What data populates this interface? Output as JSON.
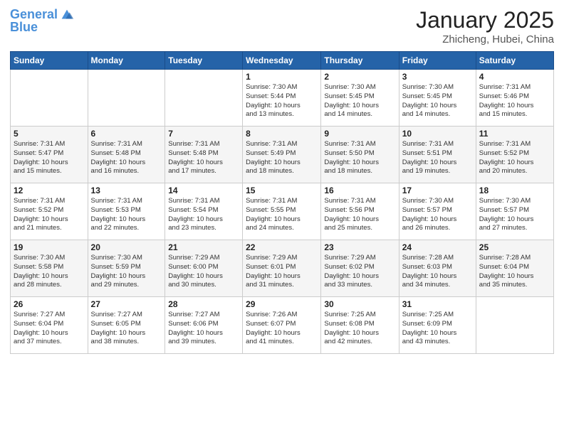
{
  "header": {
    "logo_line1": "General",
    "logo_line2": "Blue",
    "month": "January 2025",
    "location": "Zhicheng, Hubei, China"
  },
  "weekdays": [
    "Sunday",
    "Monday",
    "Tuesday",
    "Wednesday",
    "Thursday",
    "Friday",
    "Saturday"
  ],
  "weeks": [
    [
      {
        "day": "",
        "info": ""
      },
      {
        "day": "",
        "info": ""
      },
      {
        "day": "",
        "info": ""
      },
      {
        "day": "1",
        "info": "Sunrise: 7:30 AM\nSunset: 5:44 PM\nDaylight: 10 hours\nand 13 minutes."
      },
      {
        "day": "2",
        "info": "Sunrise: 7:30 AM\nSunset: 5:45 PM\nDaylight: 10 hours\nand 14 minutes."
      },
      {
        "day": "3",
        "info": "Sunrise: 7:30 AM\nSunset: 5:45 PM\nDaylight: 10 hours\nand 14 minutes."
      },
      {
        "day": "4",
        "info": "Sunrise: 7:31 AM\nSunset: 5:46 PM\nDaylight: 10 hours\nand 15 minutes."
      }
    ],
    [
      {
        "day": "5",
        "info": "Sunrise: 7:31 AM\nSunset: 5:47 PM\nDaylight: 10 hours\nand 15 minutes."
      },
      {
        "day": "6",
        "info": "Sunrise: 7:31 AM\nSunset: 5:48 PM\nDaylight: 10 hours\nand 16 minutes."
      },
      {
        "day": "7",
        "info": "Sunrise: 7:31 AM\nSunset: 5:48 PM\nDaylight: 10 hours\nand 17 minutes."
      },
      {
        "day": "8",
        "info": "Sunrise: 7:31 AM\nSunset: 5:49 PM\nDaylight: 10 hours\nand 18 minutes."
      },
      {
        "day": "9",
        "info": "Sunrise: 7:31 AM\nSunset: 5:50 PM\nDaylight: 10 hours\nand 18 minutes."
      },
      {
        "day": "10",
        "info": "Sunrise: 7:31 AM\nSunset: 5:51 PM\nDaylight: 10 hours\nand 19 minutes."
      },
      {
        "day": "11",
        "info": "Sunrise: 7:31 AM\nSunset: 5:52 PM\nDaylight: 10 hours\nand 20 minutes."
      }
    ],
    [
      {
        "day": "12",
        "info": "Sunrise: 7:31 AM\nSunset: 5:52 PM\nDaylight: 10 hours\nand 21 minutes."
      },
      {
        "day": "13",
        "info": "Sunrise: 7:31 AM\nSunset: 5:53 PM\nDaylight: 10 hours\nand 22 minutes."
      },
      {
        "day": "14",
        "info": "Sunrise: 7:31 AM\nSunset: 5:54 PM\nDaylight: 10 hours\nand 23 minutes."
      },
      {
        "day": "15",
        "info": "Sunrise: 7:31 AM\nSunset: 5:55 PM\nDaylight: 10 hours\nand 24 minutes."
      },
      {
        "day": "16",
        "info": "Sunrise: 7:31 AM\nSunset: 5:56 PM\nDaylight: 10 hours\nand 25 minutes."
      },
      {
        "day": "17",
        "info": "Sunrise: 7:30 AM\nSunset: 5:57 PM\nDaylight: 10 hours\nand 26 minutes."
      },
      {
        "day": "18",
        "info": "Sunrise: 7:30 AM\nSunset: 5:57 PM\nDaylight: 10 hours\nand 27 minutes."
      }
    ],
    [
      {
        "day": "19",
        "info": "Sunrise: 7:30 AM\nSunset: 5:58 PM\nDaylight: 10 hours\nand 28 minutes."
      },
      {
        "day": "20",
        "info": "Sunrise: 7:30 AM\nSunset: 5:59 PM\nDaylight: 10 hours\nand 29 minutes."
      },
      {
        "day": "21",
        "info": "Sunrise: 7:29 AM\nSunset: 6:00 PM\nDaylight: 10 hours\nand 30 minutes."
      },
      {
        "day": "22",
        "info": "Sunrise: 7:29 AM\nSunset: 6:01 PM\nDaylight: 10 hours\nand 31 minutes."
      },
      {
        "day": "23",
        "info": "Sunrise: 7:29 AM\nSunset: 6:02 PM\nDaylight: 10 hours\nand 33 minutes."
      },
      {
        "day": "24",
        "info": "Sunrise: 7:28 AM\nSunset: 6:03 PM\nDaylight: 10 hours\nand 34 minutes."
      },
      {
        "day": "25",
        "info": "Sunrise: 7:28 AM\nSunset: 6:04 PM\nDaylight: 10 hours\nand 35 minutes."
      }
    ],
    [
      {
        "day": "26",
        "info": "Sunrise: 7:27 AM\nSunset: 6:04 PM\nDaylight: 10 hours\nand 37 minutes."
      },
      {
        "day": "27",
        "info": "Sunrise: 7:27 AM\nSunset: 6:05 PM\nDaylight: 10 hours\nand 38 minutes."
      },
      {
        "day": "28",
        "info": "Sunrise: 7:27 AM\nSunset: 6:06 PM\nDaylight: 10 hours\nand 39 minutes."
      },
      {
        "day": "29",
        "info": "Sunrise: 7:26 AM\nSunset: 6:07 PM\nDaylight: 10 hours\nand 41 minutes."
      },
      {
        "day": "30",
        "info": "Sunrise: 7:25 AM\nSunset: 6:08 PM\nDaylight: 10 hours\nand 42 minutes."
      },
      {
        "day": "31",
        "info": "Sunrise: 7:25 AM\nSunset: 6:09 PM\nDaylight: 10 hours\nand 43 minutes."
      },
      {
        "day": "",
        "info": ""
      }
    ]
  ]
}
